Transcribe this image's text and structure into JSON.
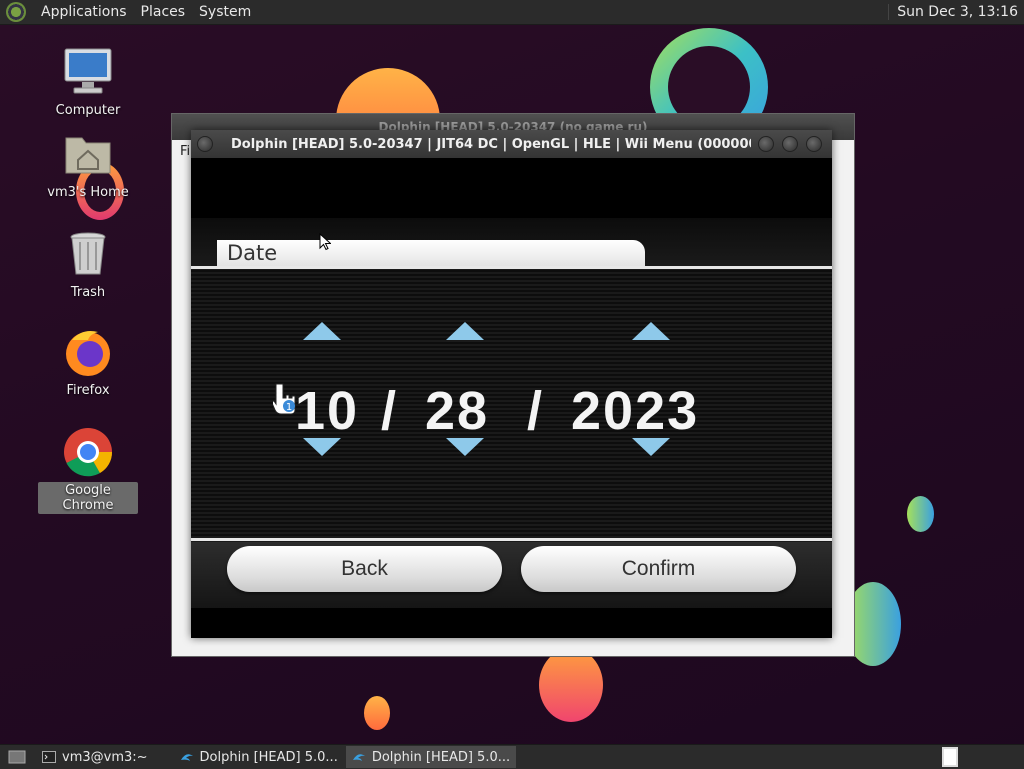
{
  "top_panel": {
    "menus": [
      "Applications",
      "Places",
      "System"
    ],
    "clock": "Sun Dec  3, 13:16"
  },
  "desktop": {
    "icons": [
      {
        "label": "Computer",
        "icon": "computer-icon"
      },
      {
        "label": "vm3's Home",
        "icon": "home-folder-icon"
      },
      {
        "label": "Trash",
        "icon": "trash-icon"
      },
      {
        "label": "Firefox",
        "icon": "firefox-icon"
      },
      {
        "label": "Google Chrome",
        "icon": "chrome-icon",
        "selected": true
      }
    ]
  },
  "back_window": {
    "title": "Dolphin [HEAD] 5.0-20347 (no game ru)",
    "menu_letter": "Fi"
  },
  "dolphin_window": {
    "title": "Dolphin [HEAD] 5.0-20347 | JIT64 DC | OpenGL | HLE | Wii Menu (0000000100000...",
    "screen": {
      "header": "Date",
      "month": "10",
      "day": "28",
      "year": "2023",
      "separator": "/",
      "pointer_badge": "1",
      "back_label": "Back",
      "confirm_label": "Confirm"
    }
  },
  "taskbar": {
    "tasks": [
      {
        "label": "vm3@vm3:~",
        "icon": "terminal-icon"
      },
      {
        "label": "Dolphin [HEAD] 5.0...",
        "icon": "dolphin-icon"
      },
      {
        "label": "Dolphin [HEAD] 5.0...",
        "icon": "dolphin-icon",
        "active": true
      }
    ]
  }
}
